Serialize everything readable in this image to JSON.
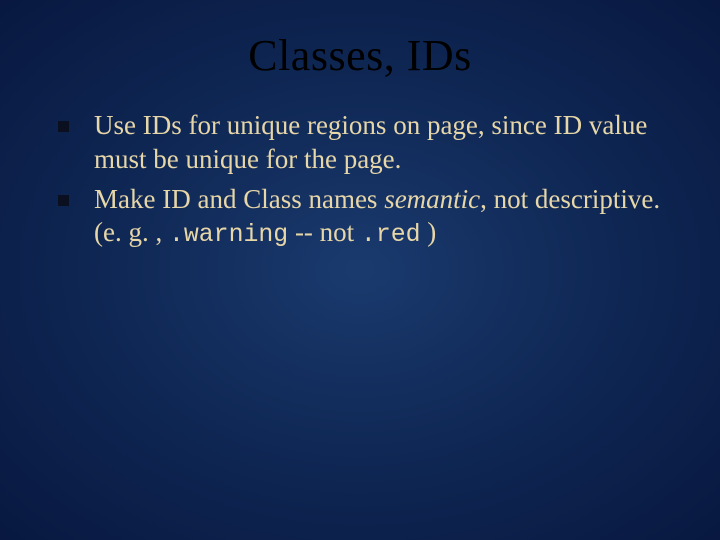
{
  "title": "Classes, IDs",
  "bullets": [
    {
      "pre": "Use IDs for unique regions on page, since ID value must be unique for the page."
    },
    {
      "pre": "Make ID and Class names ",
      "em": "semantic",
      "mid": ", not descriptive.  (e. g. , ",
      "code1": ".warning",
      "sep": " -- not ",
      "code2": ".red",
      "post": "  )"
    }
  ]
}
